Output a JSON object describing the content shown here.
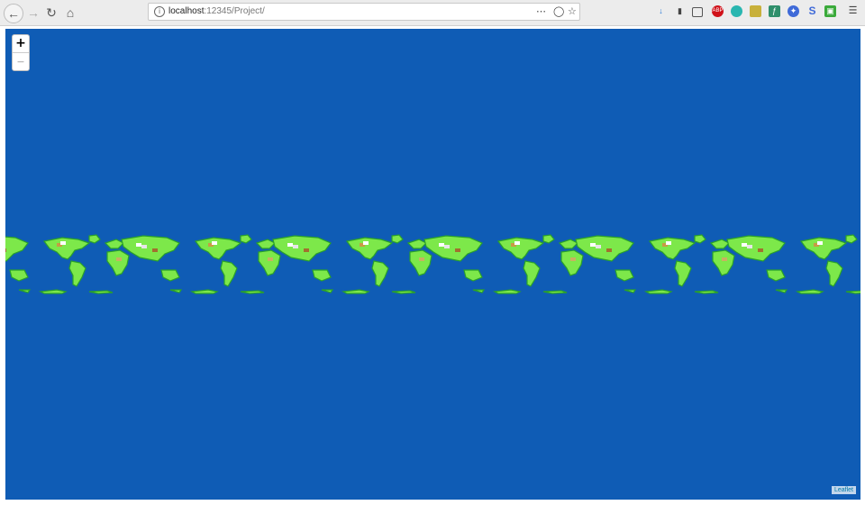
{
  "browser": {
    "back_icon": "arrow-left-icon",
    "forward_icon": "arrow-right-icon",
    "reload_icon": "reload-icon",
    "home_icon": "home-icon",
    "url_host": "localhost",
    "url_rest": ":12345/Project/",
    "page_actions_icon": "more-dots-icon",
    "pocket_icon": "pocket-icon",
    "bookmark_icon": "star-icon",
    "extensions": [
      "download-icon",
      "library-icon",
      "sidebar-icon",
      "adblock-icon",
      "globe-icon",
      "image-icon",
      "script-icon",
      "tracker-icon",
      "stylus-icon",
      "vpn-icon",
      "menu-icon"
    ]
  },
  "map": {
    "ocean_color": "#0f5cb5",
    "land_color": "#7de84a",
    "land_dark_color": "#2aa12a",
    "zoom_in_label": "+",
    "zoom_out_label": "−",
    "world_copies": 6,
    "attribution": "Leaflet"
  }
}
